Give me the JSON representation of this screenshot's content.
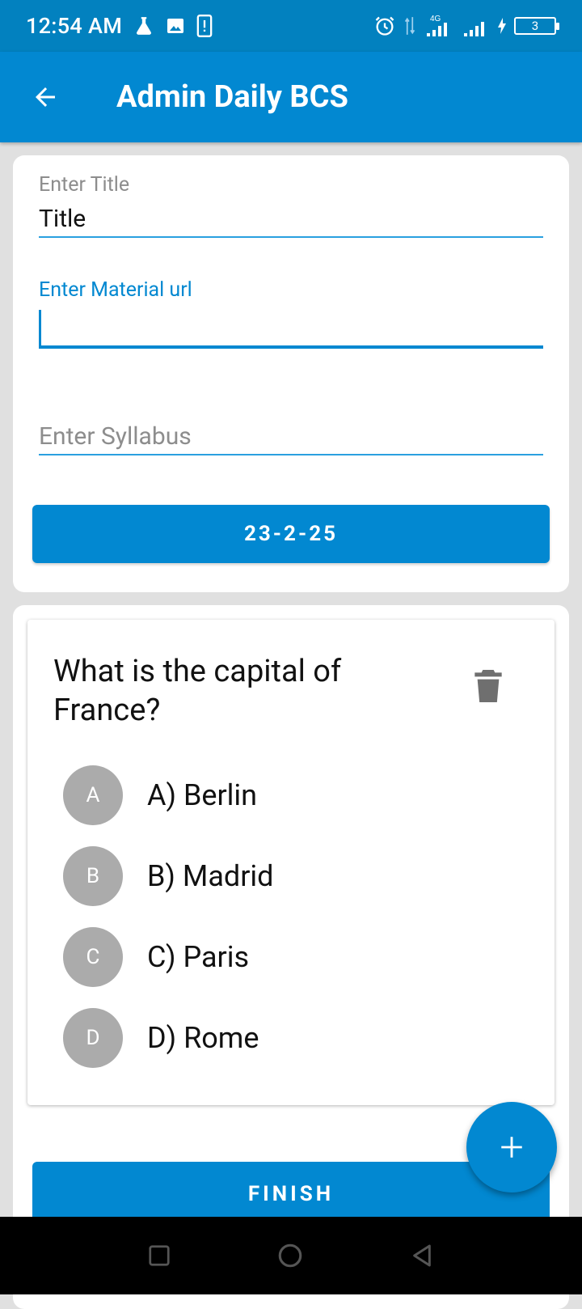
{
  "status_bar": {
    "time": "12:54 AM",
    "network": "4G",
    "battery": "3",
    "icons": [
      "flask-icon",
      "image-icon",
      "phone-alert-icon",
      "alarm-icon",
      "data-arrows-icon",
      "signal-icon",
      "signal-icon",
      "charging-icon",
      "battery-icon"
    ]
  },
  "app_bar": {
    "back_icon": "arrow-left-icon",
    "title": "Admin Daily BCS"
  },
  "form": {
    "title_label": "Enter Title",
    "title_value": "Title",
    "material_label": "Enter Material url",
    "material_value": "",
    "syllabus_placeholder": "Enter Syllabus",
    "date_button": "23-2-25"
  },
  "question_card": {
    "question": "What is the capital of France?",
    "delete_icon": "trash-icon",
    "options": [
      {
        "letter": "A",
        "text": "A) Berlin"
      },
      {
        "letter": "B",
        "text": "B) Madrid"
      },
      {
        "letter": "C",
        "text": "C) Paris"
      },
      {
        "letter": "D",
        "text": "D) Rome"
      }
    ]
  },
  "actions": {
    "finish_label": "FINISH",
    "fab_icon": "plus-icon"
  },
  "nav_bar": {
    "icons": [
      "recent-apps-icon",
      "home-icon",
      "back-icon"
    ]
  },
  "colors": {
    "primary": "#0288d1",
    "status_bar": "#0281bf",
    "option_circle": "#ababab",
    "background": "#e0e0e0"
  }
}
